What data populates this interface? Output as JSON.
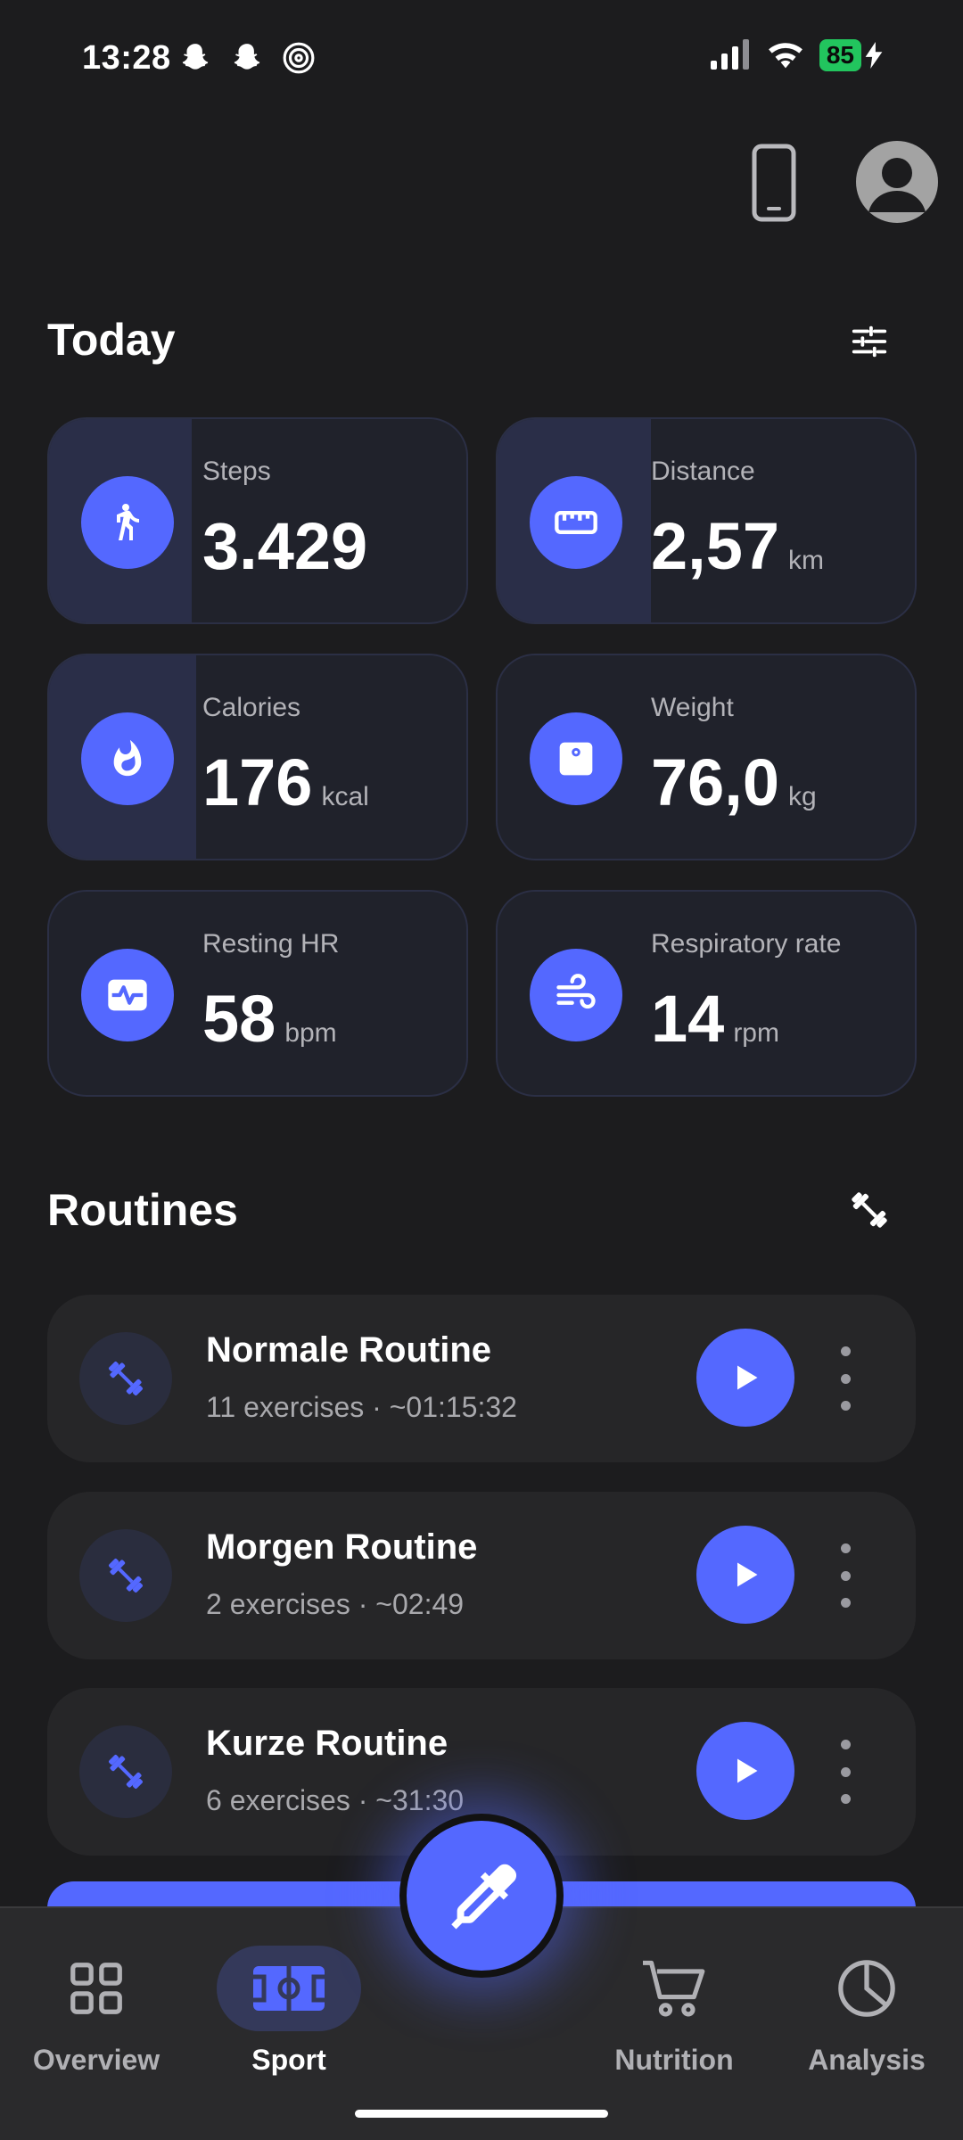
{
  "status_bar": {
    "time": "13:28",
    "left_icons": [
      "snapchat-icon",
      "snapchat-icon",
      "target-icon"
    ],
    "right_icons": [
      "signal-icon",
      "wifi-icon",
      "battery-icon",
      "charging-bolt-icon"
    ],
    "battery": "85"
  },
  "today": {
    "title": "Today",
    "cards": [
      {
        "label": "Steps",
        "value": "3.429",
        "unit": "",
        "icon": "walking-icon",
        "progress": 0.34
      },
      {
        "label": "Distance",
        "value": "2,57",
        "unit": "km",
        "icon": "ruler-icon",
        "progress": 0.37
      },
      {
        "label": "Calories",
        "value": "176",
        "unit": "kcal",
        "icon": "flame-icon",
        "progress": 0.35
      },
      {
        "label": "Weight",
        "value": "76,0",
        "unit": "kg",
        "icon": "scale-icon",
        "progress": 0
      },
      {
        "label": "Resting HR",
        "value": "58",
        "unit": "bpm",
        "icon": "heart-monitor-icon",
        "progress": 0
      },
      {
        "label": "Respiratory rate",
        "value": "14",
        "unit": "rpm",
        "icon": "wind-icon",
        "progress": 0
      }
    ]
  },
  "routines": {
    "title": "Routines",
    "items": [
      {
        "name": "Normale Routine",
        "meta": "11 exercises · ~01:15:32"
      },
      {
        "name": "Morgen Routine",
        "meta": "2 exercises · ~02:49"
      },
      {
        "name": "Kurze Routine",
        "meta": "6 exercises · ~31:30"
      }
    ]
  },
  "nav": {
    "overview": "Overview",
    "sport": "Sport",
    "nutrition": "Nutrition",
    "analysis": "Analysis"
  },
  "colors": {
    "accent": "#5468ff",
    "background": "#1c1c1e",
    "card": "#20222b",
    "battery": "#22c55e"
  }
}
